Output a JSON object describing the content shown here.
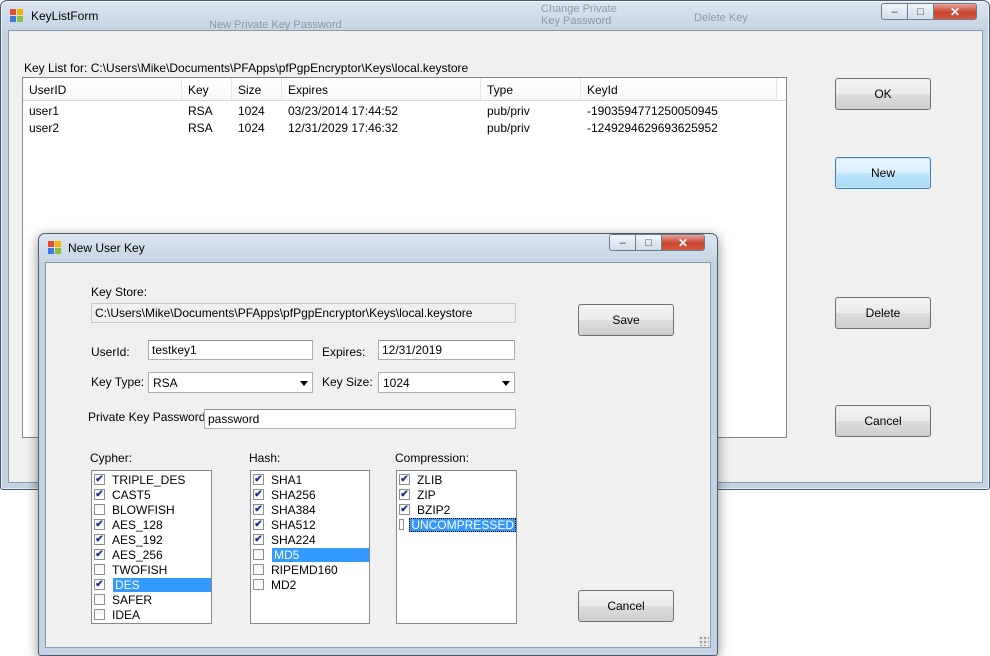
{
  "main_window": {
    "title": "KeyListForm",
    "keylist_label": "Key List for: C:\\Users\\Mike\\Documents\\PFApps\\pfPgpEncryptor\\Keys\\local.keystore",
    "columns": [
      "UserID",
      "Key",
      "Size",
      "Expires",
      "Type",
      "KeyId"
    ],
    "rows": [
      [
        "user1",
        "RSA",
        "1024",
        "03/23/2014 17:44:52",
        "pub/priv",
        "-1903594771250050945"
      ],
      [
        "user2",
        "RSA",
        "1024",
        "12/31/2029 17:46:32",
        "pub/priv",
        "-1249294629693625952"
      ]
    ],
    "buttons": {
      "ok": "OK",
      "new": "New",
      "delete": "Delete",
      "cancel": "Cancel"
    }
  },
  "dialog": {
    "title": "New User Key",
    "key_store_label": "Key Store:",
    "key_store_path": "C:\\Users\\Mike\\Documents\\PFApps\\pfPgpEncryptor\\Keys\\local.keystore",
    "userid_label": "UserId:",
    "userid_value": "testkey1",
    "expires_label": "Expires:",
    "expires_value": "12/31/2019",
    "key_type_label": "Key Type:",
    "key_type_value": "RSA",
    "key_size_label": "Key Size:",
    "key_size_value": "1024",
    "password_label": "Private Key Password:",
    "password_value": "password",
    "save_label": "Save",
    "cancel_label": "Cancel",
    "cypher_label": "Cypher:",
    "hash_label": "Hash:",
    "compression_label": "Compression:",
    "cypher_items": [
      {
        "label": "TRIPLE_DES",
        "checked": true
      },
      {
        "label": "CAST5",
        "checked": true
      },
      {
        "label": "BLOWFISH",
        "checked": false
      },
      {
        "label": "AES_128",
        "checked": true
      },
      {
        "label": "AES_192",
        "checked": true
      },
      {
        "label": "AES_256",
        "checked": true
      },
      {
        "label": "TWOFISH",
        "checked": false
      },
      {
        "label": "DES",
        "checked": true,
        "selected": true
      },
      {
        "label": "SAFER",
        "checked": false
      },
      {
        "label": "IDEA",
        "checked": false
      }
    ],
    "hash_items": [
      {
        "label": "SHA1",
        "checked": true
      },
      {
        "label": "SHA256",
        "checked": true
      },
      {
        "label": "SHA384",
        "checked": true
      },
      {
        "label": "SHA512",
        "checked": true
      },
      {
        "label": "SHA224",
        "checked": true
      },
      {
        "label": "MD5",
        "checked": false,
        "selected": true
      },
      {
        "label": "RIPEMD160",
        "checked": false
      },
      {
        "label": "MD2",
        "checked": false
      }
    ],
    "compression_items": [
      {
        "label": "ZLIB",
        "checked": true
      },
      {
        "label": "ZIP",
        "checked": true
      },
      {
        "label": "BZIP2",
        "checked": true
      },
      {
        "label": "UNCOMPRESSED",
        "checked": false,
        "selected": true,
        "focused": true
      }
    ]
  },
  "background_window_text": {
    "item1": "New Private Key Password",
    "item2": "Change Private",
    "item3": "Key Password",
    "item4": "Delete Key"
  },
  "icons": {
    "app": "windows-form-icon",
    "minimize": "minimize-icon",
    "maximize": "maximize-icon",
    "close": "close-icon",
    "dropdown": "chevron-down-icon",
    "check": "checkmark-icon"
  },
  "colors": {
    "selection": "#3399ff",
    "client_bg": "#f0f0f0",
    "close_button": "#c7452f",
    "frame": "#c4d3e3"
  }
}
